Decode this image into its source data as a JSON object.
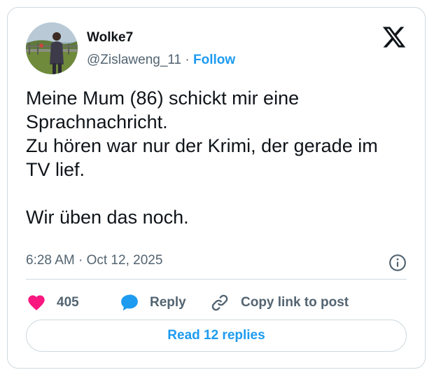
{
  "author": {
    "display_name": "Wolke7",
    "handle": "@Zislaweng_11",
    "separator": "·",
    "follow_label": "Follow"
  },
  "post": {
    "text": "Meine Mum (86) schickt mir eine\nSprachnachricht.\nZu hören war nur der Krimi, der gerade im\nTV lief.\n\nWir üben das noch.",
    "timestamp": "6:28 AM · Oct 12, 2025"
  },
  "actions": {
    "like_count": "405",
    "reply_label": "Reply",
    "copy_link_label": "Copy link to post"
  },
  "footer": {
    "read_replies_label": "Read 12 replies"
  },
  "icons": {
    "brand": "x-logo-icon",
    "info": "info-icon",
    "like": "heart-icon",
    "reply": "speech-bubble-icon",
    "copy": "link-icon"
  },
  "colors": {
    "accent": "#1d9bf0",
    "like": "#f91880",
    "text": "#0f1419",
    "secondary": "#536471",
    "border": "#cfd9de"
  }
}
